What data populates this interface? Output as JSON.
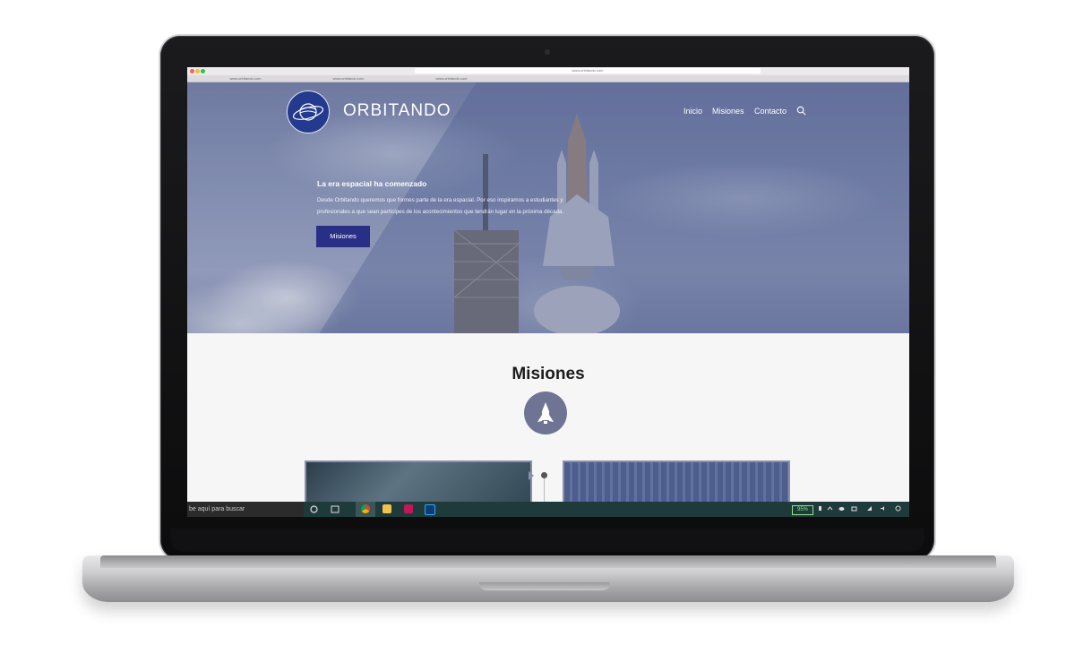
{
  "browser": {
    "url": "www.orbitando.com",
    "tabs": [
      "www.orbitando.com",
      "www.orbitando.com",
      "www.orbitando.com"
    ]
  },
  "site": {
    "brand": "ORBITANDO",
    "nav": {
      "inicio": "Inicio",
      "misiones": "Misiones",
      "contacto": "Contacto"
    },
    "hero": {
      "title": "La era espacial ha comenzado",
      "text": "Desde Orbitando queremos que formes parte de la era espacial. Por eso inspiramos a estudiantes y profesionales a que sean partícipes de los acontecimientos que tendrán lugar en la próxima década.",
      "button": "Misiones"
    },
    "section": {
      "title": "Misiones"
    }
  },
  "taskbar": {
    "search_placeholder": "be aquí para buscar",
    "battery": "95%"
  },
  "colors": {
    "accent": "#2a2f86",
    "logo_bg": "#243a8e",
    "icon_circle": "#6f7494"
  }
}
